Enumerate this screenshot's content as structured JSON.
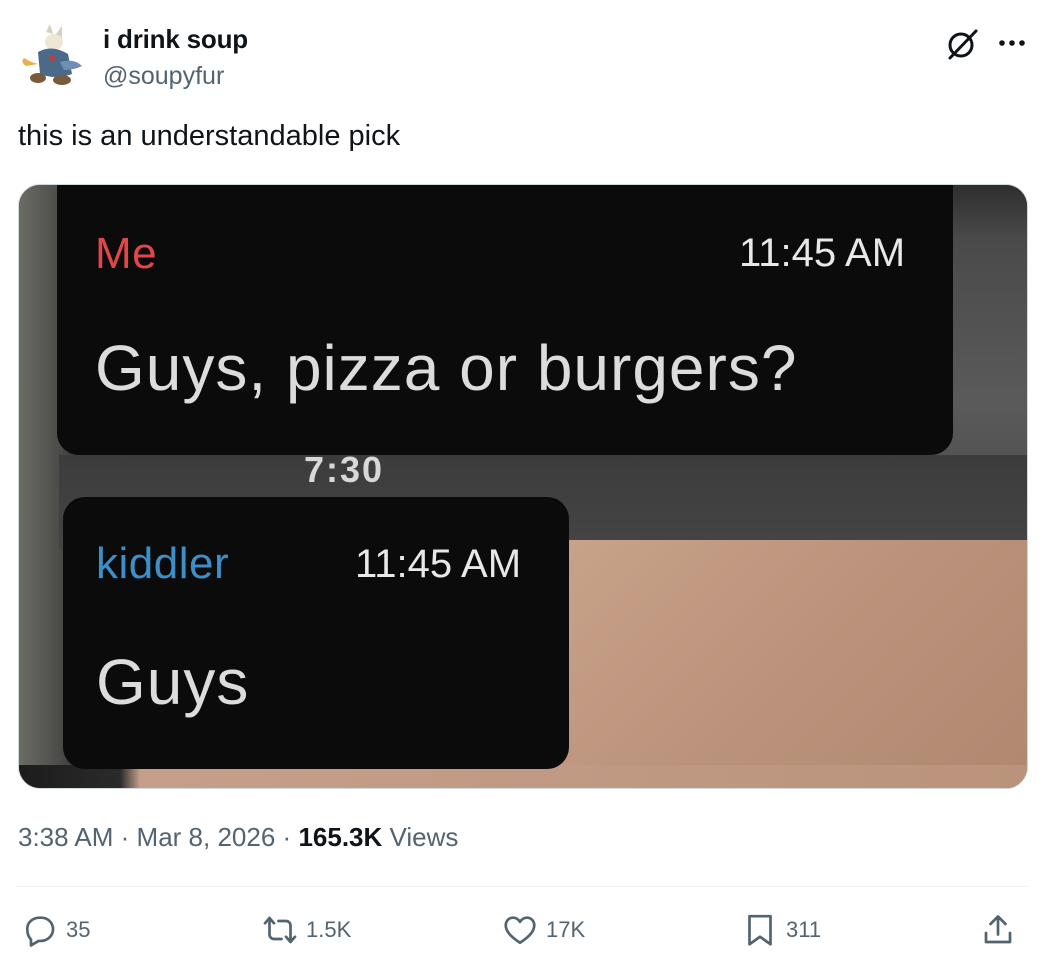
{
  "author": {
    "display_name": "i drink soup",
    "handle": "@soupyfur"
  },
  "tweet": {
    "text": "this is an understandable pick"
  },
  "media": {
    "message1": {
      "sender": "Me",
      "time": "11:45 AM",
      "text": "Guys, pizza or burgers?"
    },
    "message2": {
      "sender": "kiddler",
      "time": "11:45 AM",
      "text": "Guys"
    },
    "ghost_text": "7:30",
    "colors": {
      "bubble": "#0b0b0b",
      "sender_me": "#e0474a",
      "sender_kiddler": "#3e8fc8"
    }
  },
  "meta": {
    "time": "3:38 AM",
    "separator": "·",
    "date": "Mar 8, 2026",
    "views_count": "165.3K",
    "views_label": "Views"
  },
  "actions": {
    "replies": "35",
    "reposts": "1.5K",
    "likes": "17K",
    "bookmarks": "311"
  },
  "icons": {
    "grok": "grok-icon",
    "more": "more-icon",
    "reply": "reply-icon",
    "repost": "repost-icon",
    "like": "heart-icon",
    "bookmark": "bookmark-icon",
    "share": "share-icon"
  }
}
